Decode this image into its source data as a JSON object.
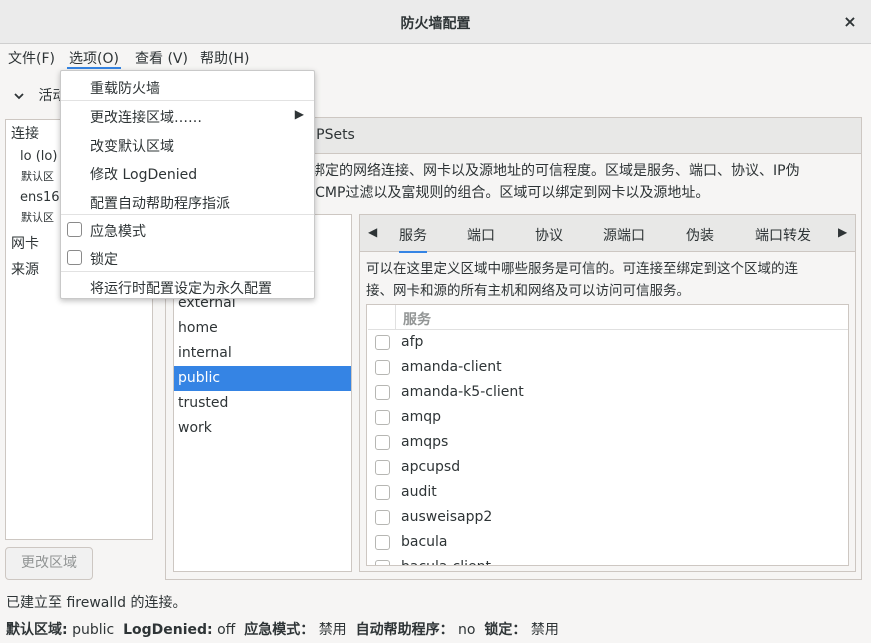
{
  "window": {
    "title": "防火墙配置",
    "close_icon": "×"
  },
  "menubar": {
    "file": "文件(F)",
    "options": "选项(O)",
    "view": "查看 (V)",
    "help": "帮助(H)"
  },
  "active_bindings": {
    "label": "活动",
    "toggle_glyph": "⌄"
  },
  "left_panel": {
    "connections_header": "连接",
    "connections": [
      {
        "name": "lo (lo)",
        "zone": "默认区"
      },
      {
        "name": "ens160",
        "zone": "默认区"
      }
    ],
    "nic_header": "网卡",
    "source_header": "来源",
    "change_zone_button": "更改区域"
  },
  "top_tabs": {
    "ipsets": "IPSets"
  },
  "zone_description": [
    "绑定的网络连接、网卡以及源地址的可信程度。区域是服务、端口、协议、IP伪",
    "ICMP过滤以及富规则的组合。区域可以绑定到网卡以及源地址。"
  ],
  "zones": [
    "external",
    "home",
    "internal",
    "public",
    "trusted",
    "work"
  ],
  "selected_zone": "public",
  "inner_tabs": [
    "服务",
    "端口",
    "协议",
    "源端口",
    "伪装",
    "端口转发"
  ],
  "services_description": [
    "可以在这里定义区域中哪些服务是可信的。可连接至绑定到这个区域的连",
    "接、网卡和源的所有主机和网络及可以访问可信服务。"
  ],
  "services_header": "服务",
  "services": [
    "afp",
    "amanda-client",
    "amanda-k5-client",
    "amqp",
    "amqps",
    "apcupsd",
    "audit",
    "ausweisapp2",
    "bacula",
    "bacula-client"
  ],
  "status": {
    "connection": "已建立至 firewalld 的连接。",
    "default_zone_label": "默认区域:",
    "default_zone_value": "public",
    "logdenied_label": "LogDenied:",
    "logdenied_value": "off",
    "panic_label": "应急模式：",
    "panic_value": "禁用",
    "helper_label": "自动帮助程序：",
    "helper_value": "no",
    "lockdown_label": "锁定：",
    "lockdown_value": "禁用"
  },
  "options_menu": {
    "reload": "重载防火墙",
    "change_conn_zone": "更改连接区域……",
    "change_default_zone": "改变默认区域",
    "modify_logdenied": "修改 LogDenied",
    "configure_helpers": "配置自动帮助程序指派",
    "panic_mode": "应急模式",
    "lockdown": "锁定",
    "runtime_to_permanent": "将运行时配置设定为永久配置"
  },
  "colors": {
    "accent": "#3584e4",
    "selection": "#3584e4"
  }
}
